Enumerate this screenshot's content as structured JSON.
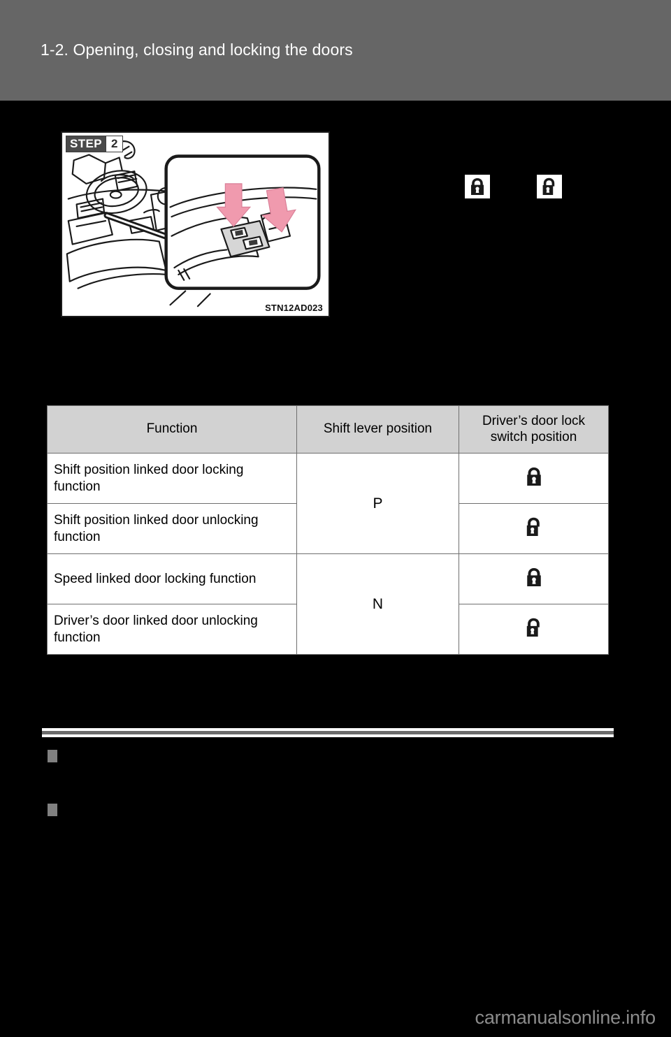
{
  "header": {
    "title": "1-2. Opening, closing and locking the doors",
    "band_color": "#666666"
  },
  "figure": {
    "step_word": "STEP",
    "step_number": "2",
    "code": "STN12AD023",
    "arrow_color": "#f09aae",
    "description": "Vehicle interior illustration showing steering wheel, dashboard and a callout of the driver's door lock switch with two pink arrows pointing down at the switch"
  },
  "symbols": {
    "locked_label": "locked",
    "unlocked_label": "unlocked"
  },
  "table": {
    "headers": {
      "function": "Function",
      "shift": "Shift lever position",
      "lock_line1": "Driver’s door lock",
      "lock_line2": "switch position"
    },
    "rows": [
      {
        "function": "Shift position linked door locking function",
        "lock_state": "locked"
      },
      {
        "function": "Shift position linked door unlocking function",
        "lock_state": "unlocked"
      },
      {
        "function": "Speed linked door locking function",
        "lock_state": "locked"
      },
      {
        "function": "Driver’s door linked door unlocking function",
        "lock_state": "unlocked"
      }
    ],
    "shift_groups": [
      {
        "value": "P",
        "rows": 2
      },
      {
        "value": "N",
        "rows": 2
      }
    ]
  },
  "footer": {
    "watermark": "carmanualsonline.info"
  }
}
